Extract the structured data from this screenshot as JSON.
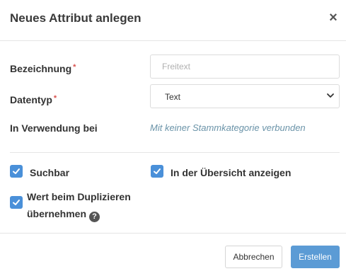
{
  "dialog": {
    "title": "Neues Attribut anlegen",
    "close_symbol": "×"
  },
  "form": {
    "name": {
      "label": "Bezeichnung",
      "required_mark": "*",
      "placeholder": "Freitext",
      "value": ""
    },
    "datatype": {
      "label": "Datentyp",
      "required_mark": "*",
      "selected": "Text"
    },
    "usage": {
      "label": "In Verwendung bei",
      "value": "Mit keiner Stammkategorie verbunden"
    }
  },
  "options": {
    "searchable": {
      "label": "Suchbar",
      "checked": true
    },
    "overview": {
      "label": "In der Übersicht anzeigen",
      "checked": true
    },
    "duplicate": {
      "label_line1": "Wert beim Duplizieren",
      "label_line2": "übernehmen",
      "checked": true,
      "help_symbol": "?"
    }
  },
  "footer": {
    "cancel_label": "Abbrechen",
    "create_label": "Erstellen"
  },
  "colors": {
    "accent": "#4a90d9",
    "primary_button": "#5b9bd5",
    "required": "#d9534f",
    "usage_text": "#6a93a8"
  }
}
